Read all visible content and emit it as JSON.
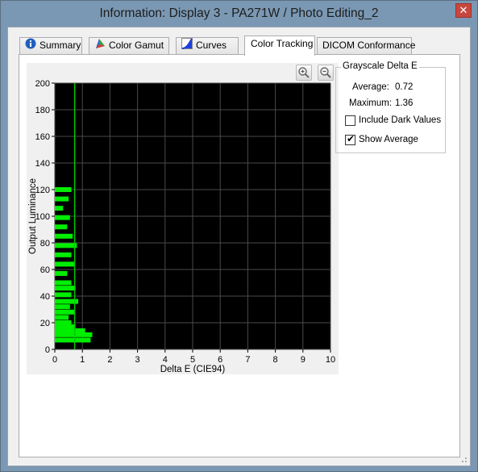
{
  "window": {
    "title": "Information: Display 3 - PA271W / Photo Editing_2",
    "close_glyph": "✕"
  },
  "tabs": [
    {
      "label": "Summary",
      "icon": "info-icon"
    },
    {
      "label": "Color Gamut",
      "icon": "color-gamut-icon"
    },
    {
      "label": "Curves",
      "icon": "curves-icon"
    },
    {
      "label": "Color Tracking",
      "icon": "",
      "active": true
    },
    {
      "label": "DICOM Conformance",
      "icon": ""
    }
  ],
  "zoom": {
    "in_icon": "zoom-in-icon",
    "out_icon": "zoom-out-icon"
  },
  "grayscale": {
    "title": "Grayscale Delta E",
    "average_label": "Average:",
    "average_value": "0.72",
    "maximum_label": "Maximum:",
    "maximum_value": "1.36",
    "include_dark_label": "Include Dark Values",
    "include_dark_checked": false,
    "show_average_label": "Show Average",
    "show_average_checked": true
  },
  "chart_data": {
    "type": "bar",
    "orientation": "horizontal",
    "xlabel": "Delta E (CIE94)",
    "ylabel": "Output Luminance",
    "xlim": [
      0,
      10
    ],
    "ylim": [
      0,
      200
    ],
    "x_ticks": [
      "0",
      "1",
      "2",
      "3",
      "4",
      "5",
      "6",
      "7",
      "8",
      "9",
      "10"
    ],
    "y_ticks": [
      "0",
      "20",
      "40",
      "60",
      "80",
      "100",
      "120",
      "140",
      "160",
      "180",
      "200"
    ],
    "grid": true,
    "background": "#000000",
    "bar_color": "#00ee00",
    "average_line": 0.72,
    "bars": [
      {
        "y": 120,
        "x": 0.6
      },
      {
        "y": 113,
        "x": 0.5
      },
      {
        "y": 106,
        "x": 0.3
      },
      {
        "y": 99,
        "x": 0.55
      },
      {
        "y": 92,
        "x": 0.45
      },
      {
        "y": 85,
        "x": 0.65
      },
      {
        "y": 78,
        "x": 0.8
      },
      {
        "y": 71,
        "x": 0.6
      },
      {
        "y": 64,
        "x": 0.7
      },
      {
        "y": 57,
        "x": 0.45
      },
      {
        "y": 50,
        "x": 0.6
      },
      {
        "y": 46,
        "x": 0.75
      },
      {
        "y": 41,
        "x": 0.6
      },
      {
        "y": 36,
        "x": 0.85
      },
      {
        "y": 32,
        "x": 0.55
      },
      {
        "y": 28,
        "x": 0.7
      },
      {
        "y": 24,
        "x": 0.5
      },
      {
        "y": 20,
        "x": 0.6
      },
      {
        "y": 17,
        "x": 0.75
      },
      {
        "y": 14,
        "x": 1.1
      },
      {
        "y": 11,
        "x": 1.36
      },
      {
        "y": 7,
        "x": 1.3
      }
    ]
  }
}
